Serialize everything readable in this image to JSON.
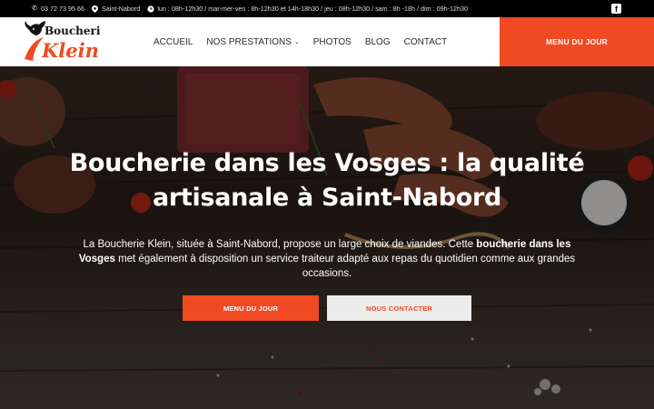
{
  "topbar": {
    "phone": "03 72 73 95 66",
    "location": "Saint-Nabord",
    "hours": "lun : 08h-12h30 / mar-mer-ven : 8h-12h30 et 14h-18h30 / jeu : 08h-12h30 / sam : 8h -18h / dim : 09h-12h30",
    "social": "f"
  },
  "logo": {
    "line1": "Boucherie",
    "line2": "Klein"
  },
  "nav": {
    "items": [
      "ACCUEIL",
      "NOS PRESTATIONS",
      "PHOTOS",
      "BLOG",
      "CONTACT"
    ],
    "cta": "MENU DU JOUR"
  },
  "hero": {
    "title_line1": "Boucherie dans les Vosges : la qualité",
    "title_line2": "artisanale à Saint-Nabord",
    "text_part1": "La Boucherie Klein, située à Saint-Nabord, propose un large choix de viandes. Cette ",
    "text_bold": "boucherie dans les Vosges",
    "text_part2": " met également à disposition un service traiteur adapté aux repas du quotidien comme aux grandes occasions.",
    "btn_menu": "MENU DU JOUR",
    "btn_contact": "NOUS CONTACTER"
  },
  "colors": {
    "accent": "#f04a22",
    "topbar": "#000000",
    "header": "#ffffff"
  }
}
